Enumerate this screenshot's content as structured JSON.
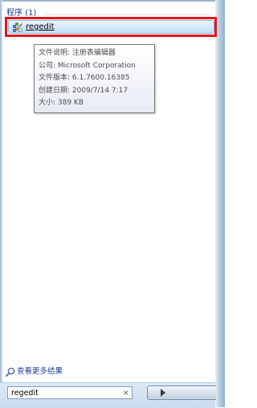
{
  "results": {
    "group_header": "程序 (1)",
    "items": [
      {
        "label": "regedit",
        "icon": "registry-editor-icon"
      }
    ]
  },
  "tooltip": {
    "lines": [
      "文件说明: 注册表编辑器",
      "公司: Microsoft Corporation",
      "文件版本: 6.1.7600.16385",
      "创建日期: 2009/7/14 7:17",
      "大小: 389 KB"
    ]
  },
  "see_more": {
    "label": "查看更多结果",
    "icon": "search-icon"
  },
  "search": {
    "value": "regedit",
    "clear_label": "×"
  },
  "shutdown": {
    "icon": "arrow-right-icon"
  },
  "colors": {
    "highlight_border": "#e0171f",
    "header_text": "#1e3d8f",
    "selection_fill": "#d6e9fb"
  }
}
